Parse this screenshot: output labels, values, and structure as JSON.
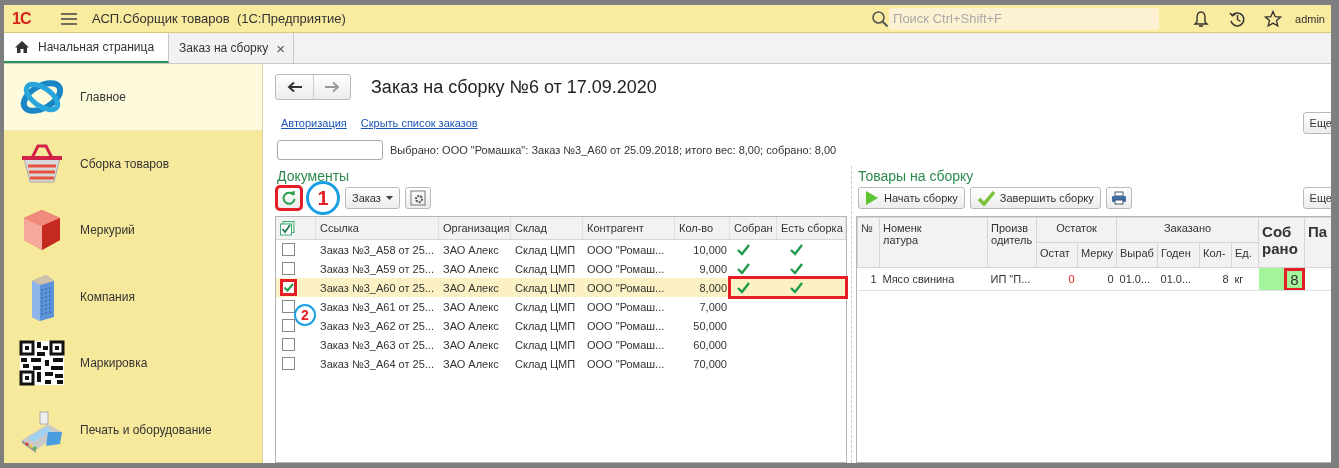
{
  "window": {
    "logo": "1С",
    "title": "АСП.Сборщик товаров  (1С:Предприятие)",
    "search_placeholder": "Поиск Ctrl+Shift+F",
    "user": "admin"
  },
  "tabs": [
    {
      "label": "Начальная страница",
      "selected": true,
      "kind": "home"
    },
    {
      "label": "Заказ на сборку",
      "selected": false,
      "kind": "closable",
      "close": "×"
    }
  ],
  "sidebar": {
    "items": [
      {
        "label": "Главное",
        "selected": true
      },
      {
        "label": "Сборка товаров",
        "selected": false
      },
      {
        "label": "Меркурий",
        "selected": false
      },
      {
        "label": "Компания",
        "selected": false
      },
      {
        "label": "Маркировка",
        "selected": false
      },
      {
        "label": "Печать и оборудование",
        "selected": false
      }
    ]
  },
  "form": {
    "title": "Заказ на сборку №6 от 17.09.2020",
    "links": [
      "Авторизация",
      "Скрыть список заказов"
    ],
    "more": "Еще",
    "summary": "Выбрано: ООО \"Ромашка\": Заказ №3_А60 от 25.09.2018; итого вес: 8,00; собрано: 8,00"
  },
  "documents": {
    "title": "Документы",
    "refresh_highlighted": true,
    "marker": "1",
    "dropdown": "Заказ",
    "header_checked": true,
    "columns": [
      "Ссылка",
      "Организация",
      "Склад",
      "Контрагент",
      "Кол-во",
      "Собран",
      "Есть сборка"
    ],
    "rows": [
      {
        "checked": false,
        "selected": false,
        "highlighted": false,
        "ref": "Заказ №3_А58 от 25...",
        "org": "ЗАО Алекс",
        "store": "Склад ЦМП",
        "partner": "ООО \"Ромаш...",
        "qty": "10,000",
        "collected": true,
        "has_assembly": true
      },
      {
        "checked": false,
        "selected": false,
        "highlighted": false,
        "ref": "Заказ №3_А59 от 25...",
        "org": "ЗАО Алекс",
        "store": "Склад ЦМП",
        "partner": "ООО \"Ромаш...",
        "qty": "9,000",
        "collected": true,
        "has_assembly": true
      },
      {
        "checked": true,
        "selected": true,
        "highlighted": true,
        "ref": "Заказ №3_А60 от 25...",
        "org": "ЗАО Алекс",
        "store": "Склад ЦМП",
        "partner": "ООО \"Ромаш...",
        "qty": "8,000",
        "collected": true,
        "has_assembly": true
      },
      {
        "checked": false,
        "selected": false,
        "highlighted": false,
        "ref": "Заказ №3_А61 от 25...",
        "org": "ЗАО Алекс",
        "store": "Склад ЦМП",
        "partner": "ООО \"Ромаш...",
        "qty": "7,000",
        "collected": false,
        "has_assembly": false
      },
      {
        "checked": false,
        "selected": false,
        "highlighted": false,
        "ref": "Заказ №3_А62 от 25...",
        "org": "ЗАО Алекс",
        "store": "Склад ЦМП",
        "partner": "ООО \"Ромаш...",
        "qty": "50,000",
        "collected": false,
        "has_assembly": false
      },
      {
        "checked": false,
        "selected": false,
        "highlighted": false,
        "ref": "Заказ №3_А63 от 25...",
        "org": "ЗАО Алекс",
        "store": "Склад ЦМП",
        "partner": "ООО \"Ромаш...",
        "qty": "60,000",
        "collected": false,
        "has_assembly": false
      },
      {
        "checked": false,
        "selected": false,
        "highlighted": false,
        "ref": "Заказ №3_А64 от 25...",
        "org": "ЗАО Алекс",
        "store": "Склад ЦМП",
        "partner": "ООО \"Ромаш...",
        "qty": "70,000",
        "collected": false,
        "has_assembly": false
      }
    ],
    "marker2": "2"
  },
  "goods": {
    "title": "Товары на сборку",
    "buttons": [
      {
        "label": "Начать сборку",
        "kind": "start"
      },
      {
        "label": "Завершить сборку",
        "kind": "finish"
      }
    ],
    "more": "Еще",
    "header_rows": [
      [
        {
          "label": "№",
          "rowspan": 2
        },
        {
          "label": "Номенклатура",
          "rowspan": 2
        },
        {
          "label": "Производитель",
          "rowspan": 2
        },
        {
          "label": "Остаток",
          "colspan": 2
        },
        {
          "label": "Заказано",
          "colspan": 4
        },
        {
          "label": "Собрано",
          "rowspan": 2,
          "kind": "bold"
        },
        {
          "label": "Па",
          "rowspan": 2,
          "kind": "bold"
        }
      ],
      [
        {
          "label": "Остат"
        },
        {
          "label": "Мерку"
        },
        {
          "label": "Выраб"
        },
        {
          "label": "Годен"
        },
        {
          "label": "Кол-"
        },
        {
          "label": "Ед."
        }
      ]
    ],
    "rows": [
      {
        "cells": [
          "1",
          "Мясо свинина",
          "ИП \"П...",
          "0",
          "0",
          "01.0...",
          "01.0...",
          "8",
          "кг"
        ],
        "stock_alert": true,
        "collected": "8",
        "complete": true,
        "highlighted": true
      }
    ]
  }
}
